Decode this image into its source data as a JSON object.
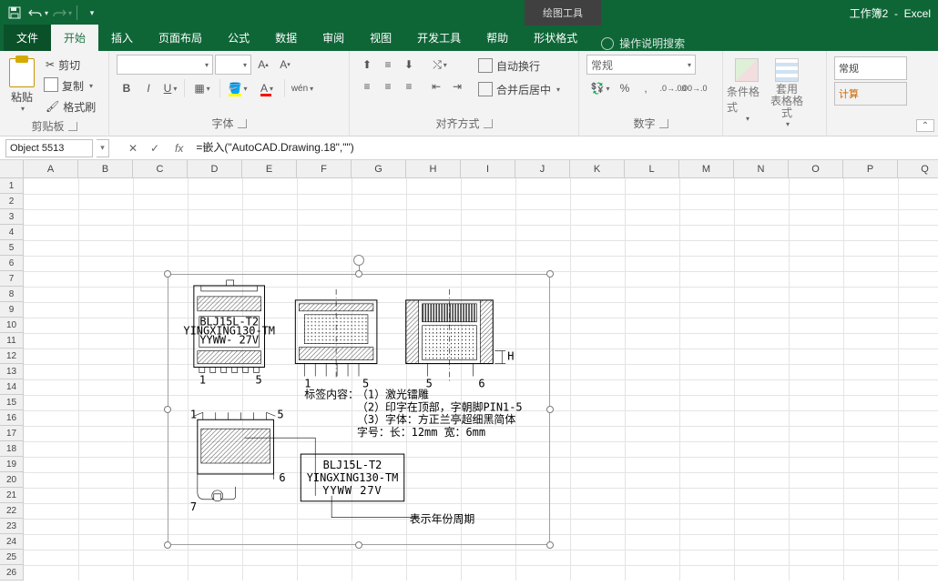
{
  "app": {
    "title_doc": "工作簿2",
    "title_app": "Excel",
    "context_tab_title": "绘图工具"
  },
  "qat": {
    "save": "保存",
    "undo": "撤销",
    "redo": "恢复"
  },
  "tabs": {
    "file": "文件",
    "home": "开始",
    "insert": "插入",
    "page_layout": "页面布局",
    "formulas": "公式",
    "data": "数据",
    "review": "审阅",
    "view": "视图",
    "dev": "开发工具",
    "help": "帮助",
    "shape_format": "形状格式",
    "tell_me": "操作说明搜索"
  },
  "ribbon": {
    "clipboard": {
      "label": "剪贴板",
      "paste": "粘贴",
      "cut": "剪切",
      "copy": "复制",
      "painter": "格式刷"
    },
    "font": {
      "label": "字体"
    },
    "alignment": {
      "label": "对齐方式",
      "wrap": "自动换行",
      "merge": "合并后居中"
    },
    "number": {
      "label": "数字",
      "format": "常规"
    },
    "styles": {
      "cond": "条件格式",
      "table": "套用\n表格格式"
    },
    "cell_styles": {
      "normal": "常规",
      "calc": "计算"
    }
  },
  "name_box": "Object 5513",
  "formula": "=嵌入(\"AutoCAD.Drawing.18\",\"\")",
  "columns": [
    "A",
    "B",
    "C",
    "D",
    "E",
    "F",
    "G",
    "H",
    "I",
    "J",
    "K",
    "L",
    "M",
    "N",
    "O",
    "P",
    "Q"
  ],
  "rows": [
    "1",
    "2",
    "3",
    "4",
    "5",
    "6",
    "7",
    "8",
    "9",
    "10",
    "11",
    "12",
    "13",
    "14",
    "15",
    "16",
    "17",
    "18",
    "19",
    "20",
    "21",
    "22",
    "23",
    "24",
    "25",
    "26"
  ],
  "cad": {
    "view1": {
      "pin_left": "1",
      "pin_right": "5",
      "text1": "BLJ15L-T2",
      "text2": "YINGXING130-TM",
      "text3": "YYWW- 27V"
    },
    "view2": {
      "pin_left": "1",
      "pin_right": "5"
    },
    "view3": {
      "pin_left": "5",
      "pin_right": "6",
      "dim_h": "H"
    },
    "view4": {
      "p1": "1",
      "p5": "5",
      "p6": "6",
      "p7": "7"
    },
    "label_title": "标签内容：",
    "lines": [
      "（1）激光镭雕",
      "（2）印字在顶部，字朝脚PIN1-5",
      "（3）字体：方正兰亭超细黑简体",
      "       字号：长：12mm  宽：6mm"
    ],
    "box": {
      "l1": "BLJ15L-T2",
      "l2": "YINGXING130-TM",
      "l3": "YYWW   27V"
    },
    "callout": "表示年份周期"
  }
}
